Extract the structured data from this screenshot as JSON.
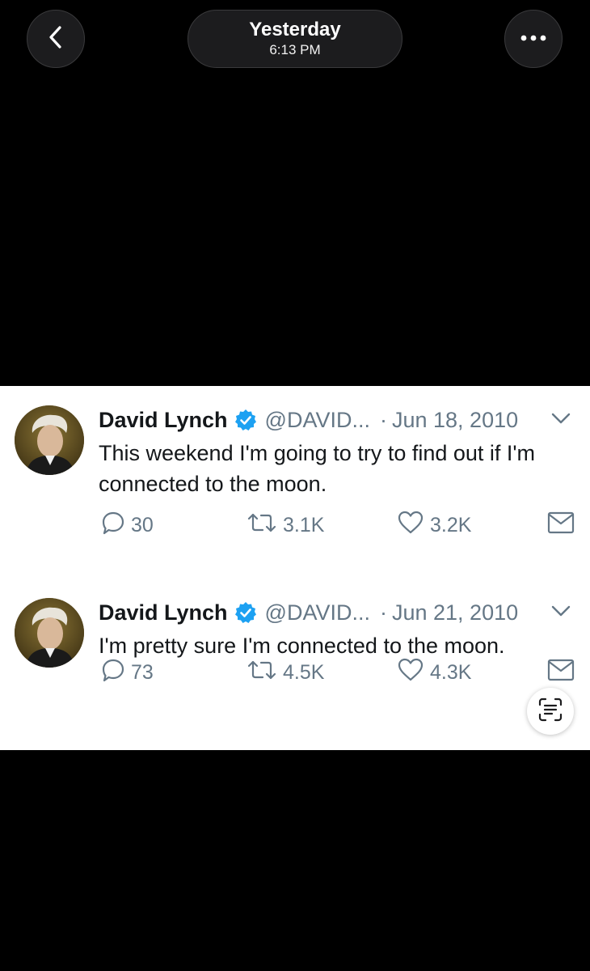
{
  "header": {
    "title": "Yesterday",
    "time": "6:13 PM",
    "back_icon": "chevron-left-icon",
    "more_icon": "ellipsis-icon"
  },
  "tweets": [
    {
      "name": "David Lynch",
      "handle": "@DAVID...",
      "separator": "·",
      "date": "Jun 18, 2010",
      "text": "This weekend I'm going to try to find out if I'm connected to the moon.",
      "replies": "30",
      "retweets": "3.1K",
      "likes": "3.2K"
    },
    {
      "name": "David Lynch",
      "handle": "@DAVID...",
      "separator": "·",
      "date": "Jun 21, 2010",
      "text": "I'm pretty sure I'm connected to the moon.",
      "replies": "73",
      "retweets": "4.5K",
      "likes": "4.3K"
    }
  ],
  "colors": {
    "background": "#000000",
    "pill": "#1c1c1e",
    "verified": "#1da1f2",
    "muted": "#657786",
    "text": "#14171a"
  },
  "live_text_icon": "live-text-icon"
}
